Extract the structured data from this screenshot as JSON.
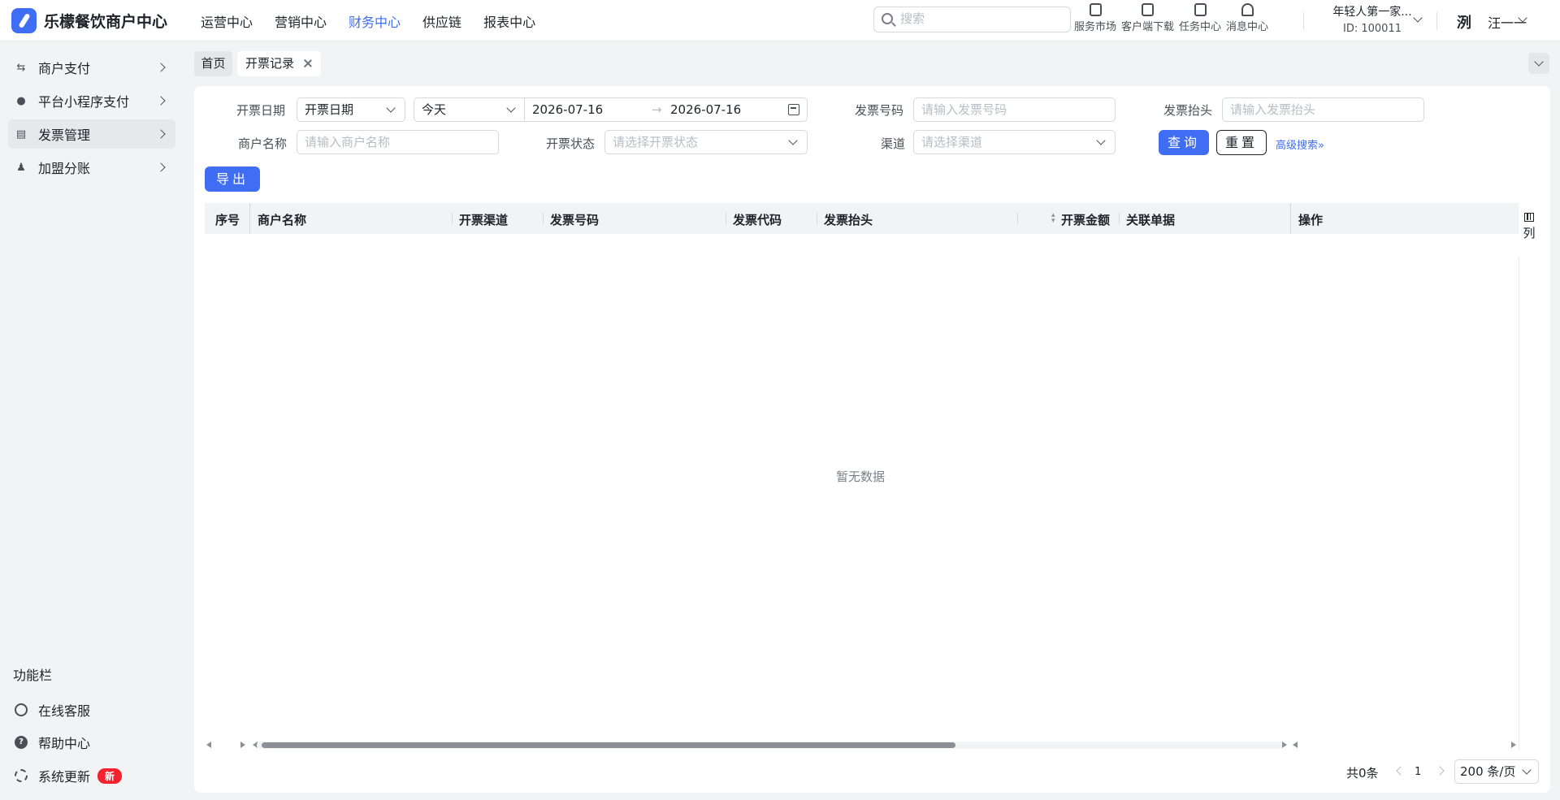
{
  "app": {
    "title": "乐檬餐饮商户中心"
  },
  "topnav": {
    "items": [
      "运营中心",
      "营销中心",
      "财务中心",
      "供应链",
      "报表中心"
    ],
    "active": "财务中心"
  },
  "search": {
    "placeholder": "搜索"
  },
  "tools": [
    "服务市场",
    "客户端下载",
    "任务中心",
    "消息中心"
  ],
  "account": {
    "name": "年轻人第一家...",
    "id": "ID: 100011"
  },
  "user": {
    "avatar_char": "洌",
    "name": "汪一一"
  },
  "sidebar": {
    "items": [
      {
        "label": "商户支付",
        "icon": "exchange-icon"
      },
      {
        "label": "平台小程序支付",
        "icon": "mini-program-icon"
      },
      {
        "label": "发票管理",
        "icon": "invoice-icon",
        "selected": true
      },
      {
        "label": "加盟分账",
        "icon": "user-add-icon"
      }
    ],
    "func_title": "功能栏",
    "func_items": [
      {
        "label": "在线客服",
        "icon": "headset-icon"
      },
      {
        "label": "帮助中心",
        "icon": "help-icon"
      },
      {
        "label": "系统更新",
        "icon": "refresh-icon",
        "badge": "新"
      }
    ]
  },
  "tabs": {
    "home": "首页",
    "active": "开票记录"
  },
  "filters": {
    "date_label": "开票日期",
    "date_type_value": "开票日期",
    "date_range_value": "今天",
    "date_start": "2026-07-16",
    "date_end": "2026-07-16",
    "invoice_no_label": "发票号码",
    "invoice_no_placeholder": "请输入发票号码",
    "invoice_title_label": "发票抬头",
    "invoice_title_placeholder": "请输入发票抬头",
    "merchant_label": "商户名称",
    "merchant_placeholder": "请输入商户名称",
    "status_label": "开票状态",
    "status_placeholder": "请选择开票状态",
    "channel_label": "渠道",
    "channel_placeholder": "请选择渠道",
    "query_button": "查询",
    "reset_button": "重置",
    "advanced_link": "高级搜索"
  },
  "toolbar": {
    "export_button": "导出"
  },
  "table": {
    "columns": [
      "序号",
      "商户名称",
      "开票渠道",
      "发票号码",
      "发票代码",
      "发票抬头",
      "开票金额",
      "关联单据",
      "操作"
    ],
    "column_setting_label": "列",
    "empty_text": "暂无数据"
  },
  "pagination": {
    "total": "共0条",
    "current_page": "1",
    "page_size": "200 条/页"
  },
  "colors": {
    "primary": "#3f6df3",
    "badge_red": "#f5222d"
  }
}
